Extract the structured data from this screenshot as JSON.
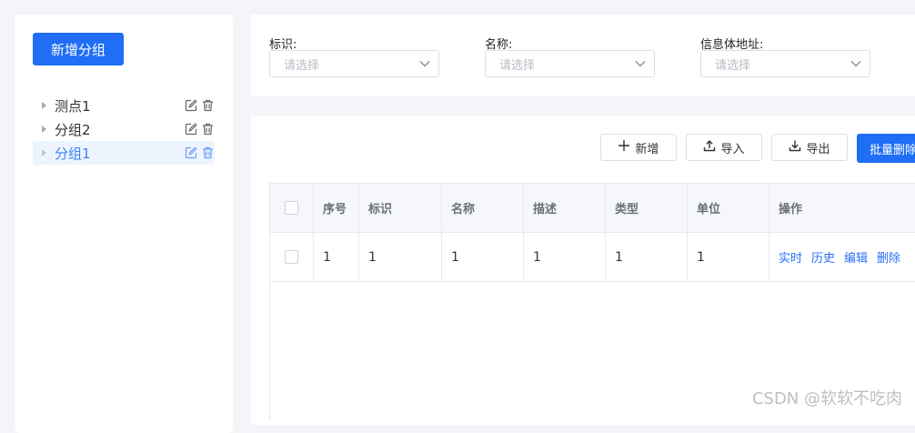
{
  "left": {
    "add_group_label": "新增分组",
    "tree": [
      {
        "label": "测点1",
        "active": false
      },
      {
        "label": "分组2",
        "active": false
      },
      {
        "label": "分组1",
        "active": true
      }
    ]
  },
  "filters": [
    {
      "label": "标识:",
      "placeholder": "请选择"
    },
    {
      "label": "名称:",
      "placeholder": "请选择"
    },
    {
      "label": "信息体地址:",
      "placeholder": "请选择"
    }
  ],
  "toolbar": {
    "add_label": "新增",
    "import_label": "导入",
    "export_label": "导出",
    "batch_delete_label": "批量删除"
  },
  "table": {
    "columns": [
      "序号",
      "标识",
      "名称",
      "描述",
      "类型",
      "单位",
      "操作"
    ],
    "rows": [
      {
        "cells": [
          "1",
          "1",
          "1",
          "1",
          "1",
          "1"
        ],
        "actions": [
          "实时",
          "历史",
          "编辑",
          "删除"
        ]
      }
    ]
  },
  "watermark": "CSDN @软软不吃肉",
  "colors": {
    "primary": "#1f6ef5",
    "link": "#2b6ff5",
    "active_bg": "#eef4fe"
  }
}
